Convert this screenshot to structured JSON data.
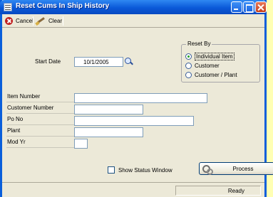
{
  "window": {
    "title": "Reset Cums In Ship History"
  },
  "toolbar": {
    "cancel_label": "Cancel",
    "clear_label": "Clear"
  },
  "form": {
    "start_date_label": "Start Date",
    "start_date_value": "10/1/2005",
    "fields": [
      {
        "label": "Item Number",
        "value": ""
      },
      {
        "label": "Customer Number",
        "value": ""
      },
      {
        "label": "Po No",
        "value": ""
      },
      {
        "label": "Plant",
        "value": ""
      },
      {
        "label": "Mod Yr",
        "value": ""
      }
    ]
  },
  "reset_by": {
    "title": "Reset By",
    "options": [
      {
        "label": "Individual Item",
        "checked": true
      },
      {
        "label": "Customer",
        "checked": false
      },
      {
        "label": "Customer / Plant",
        "checked": false
      }
    ]
  },
  "show_status": {
    "label": "Show Status Window",
    "checked": false
  },
  "process_button": {
    "label": "Process"
  },
  "status": {
    "text": "Ready"
  },
  "icons": {
    "window": "window-icon",
    "cancel": "cancel-icon",
    "clear": "clear-icon",
    "lookup": "lookup-icon",
    "process": "process-icon"
  },
  "colors": {
    "titlebar": "#0a59d8",
    "window_bg": "#ece9d8",
    "desktop": "#ffffb4"
  }
}
